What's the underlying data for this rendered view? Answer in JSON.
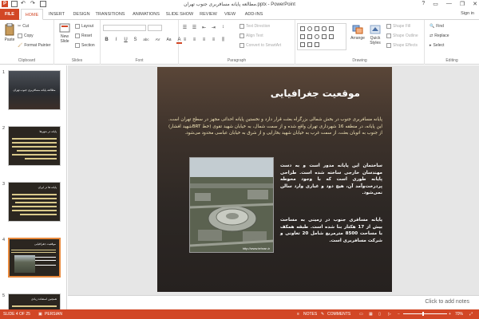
{
  "window": {
    "title": "مطالعه پایانه مسافربری جنوب تهران.pptx - PowerPoint",
    "sign_in": "Sign in",
    "controls": [
      "?",
      "▭",
      "—",
      "❐",
      "✕"
    ]
  },
  "tabs": [
    "FILE",
    "HOME",
    "INSERT",
    "DESIGN",
    "TRANSITIONS",
    "ANIMATIONS",
    "SLIDE SHOW",
    "REVIEW",
    "VIEW",
    "ADD-INS"
  ],
  "ribbon": {
    "clipboard": {
      "paste": "Paste",
      "cut": "Cut",
      "copy": "Copy",
      "format_painter": "Format Painter",
      "label": "Clipboard"
    },
    "slides": {
      "new_slide": "New Slide",
      "layout": "Layout",
      "reset": "Reset",
      "section": "Section",
      "label": "Slides"
    },
    "font": {
      "label": "Font",
      "buttons": [
        "B",
        "I",
        "U",
        "S",
        "abc",
        "AV",
        "Aa",
        "A"
      ]
    },
    "paragraph": {
      "label": "Paragraph",
      "text_direction": "Text Direction",
      "align_text": "Align Text",
      "convert_smartart": "Convert to SmartArt"
    },
    "drawing": {
      "label": "Drawing",
      "arrange": "Arrange",
      "quick_styles": "Quick Styles",
      "shape_fill": "Shape Fill",
      "shape_outline": "Shape Outline",
      "shape_effects": "Shape Effects"
    },
    "editing": {
      "label": "Editing",
      "find": "Find",
      "replace": "Replace",
      "select": "Select"
    }
  },
  "thumbnails": [
    {
      "number": "1",
      "title": "مطالعه پایانه مسافربری جنوب تهران"
    },
    {
      "number": "2",
      "title": "پایانه در شهرها"
    },
    {
      "number": "3",
      "title": "پایانه ها در ایران"
    },
    {
      "number": "4",
      "title": "موقعیت جغرافیایی"
    },
    {
      "number": "5",
      "title": "همچنین استفاده زیادی"
    }
  ],
  "slide": {
    "title": "موقعیت جغرافیایی",
    "para1": "پایانه مسافربری جنوب در بخش شمالی بزرگراه بعثت قرار دارد و نخستین پایانه احداثی مجهز در سطح تهران است. این پایانه، در منطقه 16 شهرداری تهران واقع شده و از سمت شمال، به خیابان شهید تقوی (خط BRTشهید افشار) از جنوب به اتوبان بعثت، از سمت غرب به خیابان شهید بخارایی و از شرق به خیابان عباسی محدود می‌شود.",
    "para2": "ساختمان این پایانه مدور است و به دست مهندسان خارجی ساخته شده است. طراحی پایانه طوری است که با وجود محوطه پردرخت‌وآمد آن، هیچ دود و غباری وارد سالن نمی‌شود.",
    "para3": "پایانه مسافری جنوب در زمینی به مساحت بیش از 17 هکتار بنا شده است. طبقه همکف با مساحت 8500 مترمربع شامل 20 تعاونی و شرکت مسافربری است.",
    "photo_label": "http://www.tehran.ir"
  },
  "notes_placeholder": "Click to add notes",
  "status": {
    "slide_indicator": "SLIDE 4 OF 25",
    "language": "PERSIAN",
    "notes": "NOTES",
    "comments": "COMMENTS",
    "zoom": "70%"
  },
  "colors": {
    "accent": "#d24726",
    "thumb_selected": "#e8893c"
  }
}
